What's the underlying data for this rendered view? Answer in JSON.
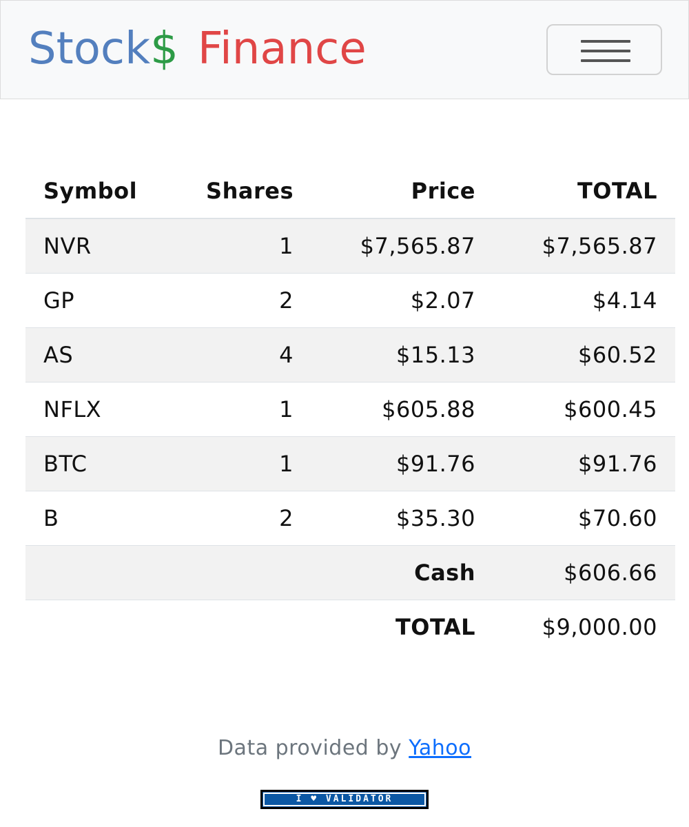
{
  "navbar": {
    "brand": {
      "part1": "Stock",
      "part2": "$",
      "part3": "Finance",
      "colors": {
        "stock": "#537fbe",
        "dollar": "#2d9b46",
        "finance": "#e04646"
      }
    },
    "toggler_icon": "hamburger-menu-icon"
  },
  "table": {
    "headers": {
      "symbol": "Symbol",
      "shares": "Shares",
      "price": "Price",
      "total": "TOTAL"
    },
    "rows": [
      {
        "symbol": "NVR",
        "shares": "1",
        "price": "$7,565.87",
        "total": "$7,565.87"
      },
      {
        "symbol": "GP",
        "shares": "2",
        "price": "$2.07",
        "total": "$4.14"
      },
      {
        "symbol": "AS",
        "shares": "4",
        "price": "$15.13",
        "total": "$60.52"
      },
      {
        "symbol": "NFLX",
        "shares": "1",
        "price": "$605.88",
        "total": "$600.45"
      },
      {
        "symbol": "BTC",
        "shares": "1",
        "price": "$91.76",
        "total": "$91.76"
      },
      {
        "symbol": "B",
        "shares": "2",
        "price": "$35.30",
        "total": "$70.60"
      }
    ],
    "cash_label": "Cash",
    "cash_value": "$606.66",
    "grand_total_label": "TOTAL",
    "grand_total_value": "$9,000.00"
  },
  "footer": {
    "prefix": "Data provided by",
    "link_text": "Yahoo",
    "badge_text": "I ♥ VALIDATOR"
  }
}
